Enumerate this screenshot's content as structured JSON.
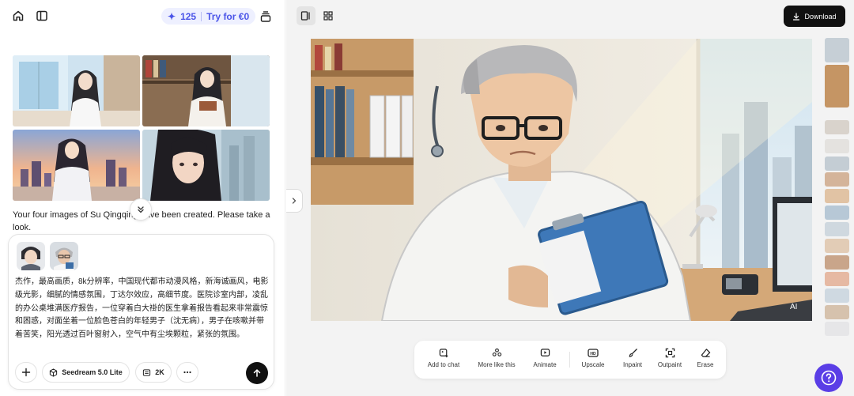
{
  "header": {
    "credits": "125",
    "try_label": "Try for €0"
  },
  "chat": {
    "message": "Your four images of Su Qingqing have been created. Please take a look.",
    "images": [
      "Su Qingqing office window",
      "Su Qingqing reading book",
      "Su Qingqing sunset city",
      "Su Qingqing portrait close"
    ]
  },
  "composer": {
    "prompt": "杰作，最高画质，8k分辨率，中国现代都市动漫风格，新海诚画风，电影级光影，细腻的情感氛围，丁达尔效应，高细节度。医院诊室内部，凌乱的办公桌堆满医疗报告，一位穿着白大褂的医生拿着报告看起来非常震惊和困惑，对面坐着一位脸色苍白的年轻男子（沈无病），男子在咳嗽并带着苦笑，阳光透过百叶窗射入，空气中有尘埃颗粒，紧张的氛围。",
    "model_label": "Seedream 5.0 Lite",
    "resolution_label": "2K"
  },
  "viewer": {
    "download_label": "Download",
    "watermark": "AI"
  },
  "tools": [
    {
      "label": "Add to chat",
      "icon": "add-image-icon"
    },
    {
      "label": "More like this",
      "icon": "sparkle-icon"
    },
    {
      "label": "Animate",
      "icon": "play-icon"
    },
    {
      "label": "Upscale",
      "icon": "hd-icon"
    },
    {
      "label": "Inpaint",
      "icon": "brush-icon"
    },
    {
      "label": "Outpaint",
      "icon": "expand-icon"
    },
    {
      "label": "Erase",
      "icon": "eraser-icon"
    }
  ],
  "colors": {
    "accent": "#4a54e8",
    "help": "#5a3ee6",
    "primary_dark": "#111111"
  }
}
